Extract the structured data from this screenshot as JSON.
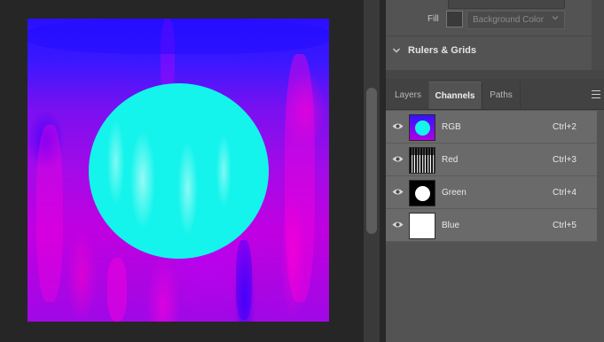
{
  "properties": {
    "fill_label": "Fill",
    "fill_value": "Background Color",
    "rulers_grids_title": "Rulers & Grids"
  },
  "tabs": [
    {
      "label": "Layers",
      "active": false
    },
    {
      "label": "Channels",
      "active": true
    },
    {
      "label": "Paths",
      "active": false
    }
  ],
  "channels": [
    {
      "name": "RGB",
      "shortcut": "Ctrl+2",
      "visible": true
    },
    {
      "name": "Red",
      "shortcut": "Ctrl+3",
      "visible": true
    },
    {
      "name": "Green",
      "shortcut": "Ctrl+4",
      "visible": true
    },
    {
      "name": "Blue",
      "shortcut": "Ctrl+5",
      "visible": true
    }
  ],
  "colors": {
    "canvas_circle": "#14f4ec",
    "canvas_blue": "#2a10ff",
    "canvas_magenta": "#c000e0",
    "panel_bg": "#535353",
    "row_bg": "#6a6a6a"
  },
  "icons": [
    "eye-icon",
    "chevron-down-icon",
    "panel-menu-icon"
  ]
}
